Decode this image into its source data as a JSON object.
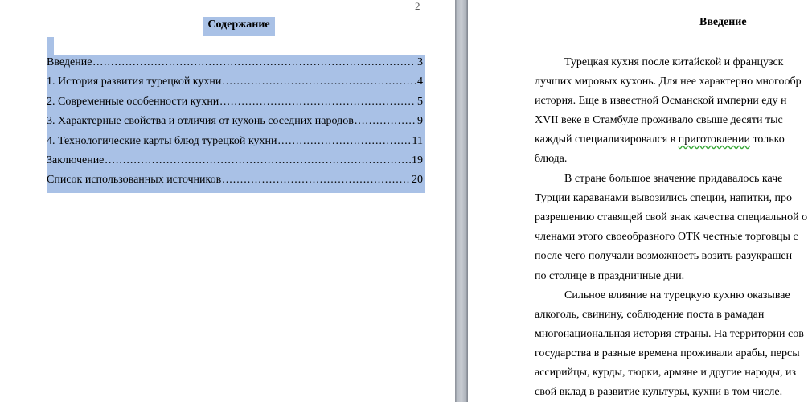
{
  "left_page": {
    "page_number": "2",
    "title": "Содержание",
    "toc": [
      {
        "text": "Введение",
        "page": "3"
      },
      {
        "text": "1. История  развития турецкой кухни",
        "page": "4"
      },
      {
        "text": "2. Современные особенности кухни",
        "page": "5"
      },
      {
        "text": "3. Характерные свойства и отличия от кухонь соседних народов",
        "page": "9"
      },
      {
        "text": "4. Технологические карты блюд турецкой кухни",
        "page": "11"
      },
      {
        "text": "Заключение",
        "page": "19"
      },
      {
        "text": "Список использованных источников",
        "page": "20"
      }
    ]
  },
  "right_page": {
    "title": "Введение",
    "lines": [
      {
        "text": "Турецкая кухня после китайской и французск"
      },
      {
        "text": "лучших мировых кухонь. Для нее характерно многообр"
      },
      {
        "text": "история. Еще в известной  Османской империи еду н"
      },
      {
        "text": "XVII веке в Стамбуле проживало свыше десяти тыс"
      },
      {
        "pre": "каждый  специализировался в ",
        "flag": "приготовлении",
        "post": " только"
      },
      {
        "text": "блюда."
      },
      {
        "text": "В стране большое значение придавалось каче"
      },
      {
        "text": "Турции караванами вывозились специи, напитки, про"
      },
      {
        "text": "разрешению ставящей свой знак качества специальной о"
      },
      {
        "text": "членами этого своеобразного ОТК честные торговцы с"
      },
      {
        "text": "после чего получали возможность  возить разукрашен"
      },
      {
        "text": "по столице в праздничные дни."
      },
      {
        "text": "Сильное влияние на турецкую кухню оказывае"
      },
      {
        "text": "алкоголь, свинину, соблюдение поста в рамадан"
      },
      {
        "text": "многонациональная история страны. На территории сов"
      },
      {
        "text": "государства в разные времена проживали арабы, персы"
      },
      {
        "text": "ассирийцы, курды, тюрки,  армяне и другие народы, из"
      },
      {
        "text": "свой вклад в развитие культуры, кухни в том числе."
      }
    ]
  },
  "colors": {
    "selection": "#a9c1e6",
    "spell_underline": "#3aa83a"
  }
}
